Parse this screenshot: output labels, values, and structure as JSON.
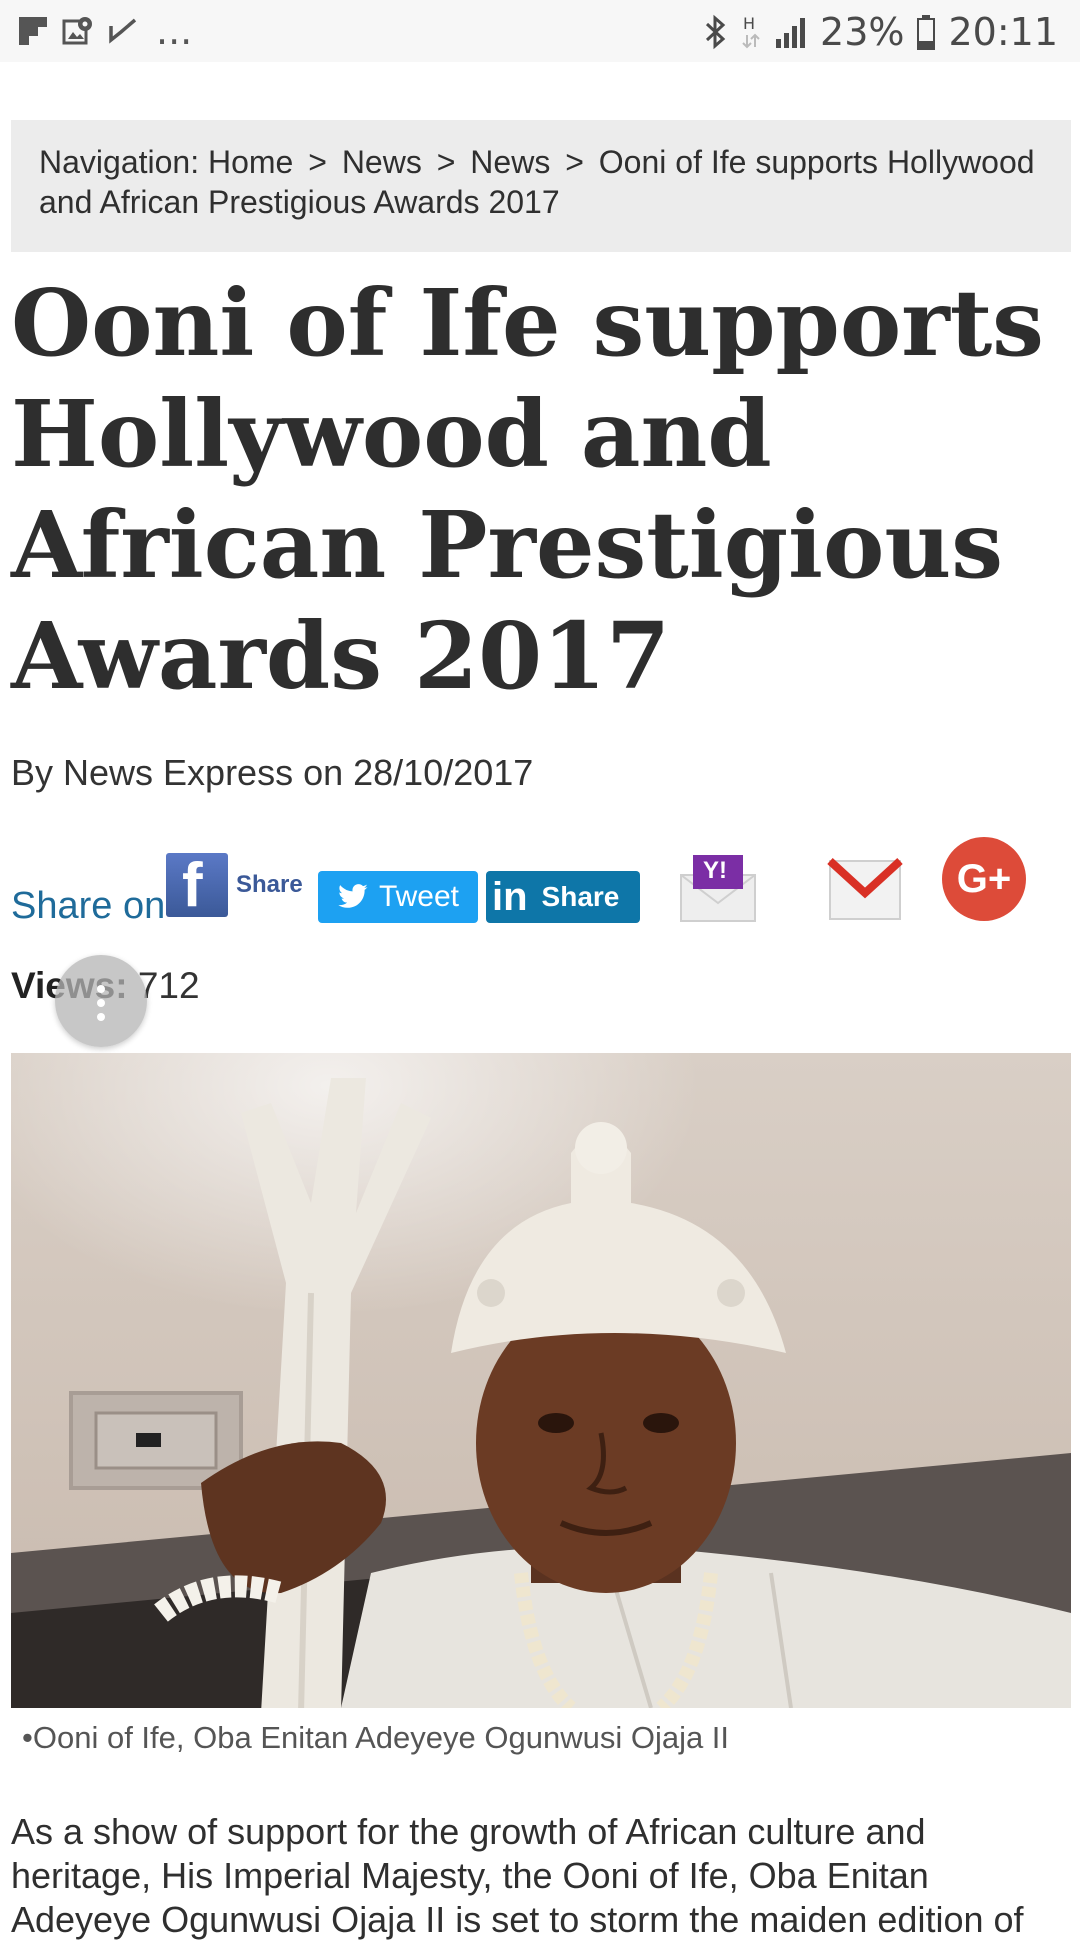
{
  "status_bar": {
    "battery": "23%",
    "time": "20:11",
    "overflow": "...",
    "icons": [
      "flipboard-icon",
      "gallery-location-icon",
      "check-icon",
      "bluetooth-icon",
      "hplus-data-icon",
      "signal-icon",
      "battery-icon"
    ]
  },
  "breadcrumb": {
    "prefix": "Navigation:",
    "items": [
      "Home",
      "News",
      "News",
      "Ooni of Ife supports Hollywood and African Prestigious Awards 2017"
    ],
    "separator": ">"
  },
  "article": {
    "title": "Ooni of Ife supports Hollywood and African Prestigious Awards 2017",
    "byline": "By News Express on 28/10/2017",
    "views_label": "Views:",
    "views_count": "712",
    "caption": "•Ooni of Ife, Oba Enitan Adeyeye Ogunwusi Ojaja II",
    "body": " As a show of support for the growth of African culture and heritage, His Imperial Majesty, the Ooni of Ife, Oba Enitan Adeyeye Ogunwusi Ojaja II is set to storm the maiden edition of"
  },
  "share": {
    "label": "Share on",
    "facebook": "Share",
    "twitter": "Tweet",
    "linkedin": "Share",
    "yahoo_mark": "Y!",
    "gmail_mark": "M",
    "gplus_mark": "G+"
  },
  "colors": {
    "share_label": "#1f6b9a",
    "facebook": "#3b5998",
    "twitter": "#1da1f2",
    "linkedin": "#0e76a8",
    "gplus": "#dd4b39",
    "breadcrumb_bg": "#ececec"
  }
}
